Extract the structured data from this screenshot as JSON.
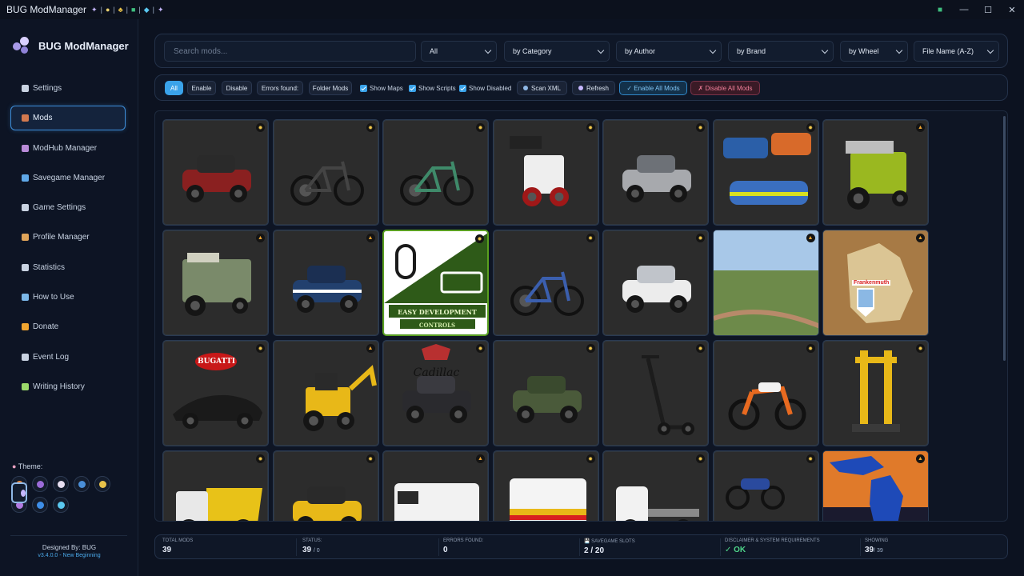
{
  "window": {
    "title": "BUG ModManager",
    "controls": {
      "minimize": "—",
      "maximize": "☐",
      "close": "✕"
    }
  },
  "brand": {
    "title": "BUG ModManager"
  },
  "sidebar": {
    "items": [
      {
        "label": "Settings",
        "icon": "gear-icon",
        "color": "#c9d3e2"
      },
      {
        "label": "Mods",
        "icon": "briefcase-icon",
        "color": "#d2794f"
      },
      {
        "label": "ModHub Manager",
        "icon": "box-icon",
        "color": "#b98bd8"
      },
      {
        "label": "Savegame Manager",
        "icon": "shield-icon",
        "color": "#5fa8e8"
      },
      {
        "label": "Game Settings",
        "icon": "sliders-icon",
        "color": "#c9d3e2"
      },
      {
        "label": "Profile Manager",
        "icon": "user-icon",
        "color": "#e0a45a"
      },
      {
        "label": "Statistics",
        "icon": "chart-icon",
        "color": "#c9d3e2"
      },
      {
        "label": "How to Use",
        "icon": "magnifier-icon",
        "color": "#7bb7e8"
      },
      {
        "label": "Donate",
        "icon": "megaphone-icon",
        "color": "#f0a530"
      },
      {
        "label": "Event Log",
        "icon": "log-icon",
        "color": "#c9d3e2"
      },
      {
        "label": "Writing History",
        "icon": "pencil-icon",
        "color": "#9bd86a"
      }
    ],
    "theme_label": "Theme:",
    "themes": [
      {
        "name": "ember-theme",
        "color": "#f08a3c"
      },
      {
        "name": "violet-theme",
        "color": "#9b6bd8"
      },
      {
        "name": "pearl-theme",
        "color": "#e8e0f2"
      },
      {
        "name": "ocean-theme",
        "color": "#4a8fd8"
      },
      {
        "name": "gold-theme",
        "color": "#e8c24a"
      },
      {
        "name": "orchid-theme",
        "color": "#b07ae0"
      },
      {
        "name": "cobalt-theme",
        "color": "#3e8ee8"
      },
      {
        "name": "bug-theme",
        "color": "#c6b8ff"
      },
      {
        "name": "sky-theme",
        "color": "#5ac8f0"
      }
    ],
    "designed_by": "Designed By: BUG",
    "version": "v3.4.0.0 - New Beginning"
  },
  "filters": {
    "search_placeholder": "Search mods...",
    "type": "All",
    "category": "by Category",
    "author": "by Author",
    "brand": "by Brand",
    "wheel": "by Wheel",
    "sort": "File Name (A-Z)"
  },
  "actions": {
    "all": "All",
    "enable": "Enable",
    "disable": "Disable",
    "errors": "Errors found:",
    "folder_mods": "Folder Mods",
    "show_maps": "Show Maps",
    "show_scripts": "Show Scripts",
    "show_disabled": "Show Disabled",
    "scan_xml": "Scan XML",
    "refresh": "Refresh",
    "enable_all": "✓ Enable All Mods",
    "disable_all": "✗ Disable All Mods"
  },
  "mods": [
    {
      "name": "atv-quad-red",
      "status": "ok"
    },
    {
      "name": "mountain-bike",
      "status": "ok"
    },
    {
      "name": "city-bicycle",
      "status": "ok"
    },
    {
      "name": "skid-steer-loader",
      "status": "ok"
    },
    {
      "name": "silver-suv",
      "status": "ok"
    },
    {
      "name": "police-cars-pack",
      "status": "ok"
    },
    {
      "name": "combine-harvester-green",
      "status": "warn"
    },
    {
      "name": "vintage-combine",
      "status": "warn"
    },
    {
      "name": "offroad-jeep-blue",
      "status": "warn"
    },
    {
      "name": "easy-development-controls",
      "status": "ok",
      "logo_text": "EASY DEVELOPMENT",
      "logo_sub": "CONTROLS"
    },
    {
      "name": "blue-bicycle",
      "status": "ok"
    },
    {
      "name": "white-sedan",
      "status": "ok"
    },
    {
      "name": "farm-map-aerial",
      "status": "warn"
    },
    {
      "name": "frankenmuth-map",
      "status": "warn",
      "map_label": "Frankenmuth"
    },
    {
      "name": "bugatti-hypercar",
      "status": "ok",
      "logo_text": "BUGATTI"
    },
    {
      "name": "backhoe-loader-yellow",
      "status": "warn"
    },
    {
      "name": "cadillac-suv",
      "status": "ok",
      "logo_text": "Cadillac"
    },
    {
      "name": "military-jeep",
      "status": "ok"
    },
    {
      "name": "electric-scooter",
      "status": "ok"
    },
    {
      "name": "dirt-bike",
      "status": "ok"
    },
    {
      "name": "crane-tower",
      "status": "ok"
    },
    {
      "name": "dump-truck",
      "status": "ok"
    },
    {
      "name": "atv-quad-yellow",
      "status": "ok"
    },
    {
      "name": "white-van",
      "status": "warn"
    },
    {
      "name": "ambulance-van",
      "status": "ok"
    },
    {
      "name": "flatbed-truck",
      "status": "ok"
    },
    {
      "name": "blue-motorcycles",
      "status": "ok"
    },
    {
      "name": "michigan-map",
      "status": "warn"
    }
  ],
  "status_icons": {
    "ok": "✹",
    "warn": "▲"
  },
  "footer": {
    "total_mods_label": "TOTAL MODS",
    "total_mods": "39",
    "status_label": "STATUS:",
    "status_value": "39",
    "status_sub": "/ 0",
    "errors_label": "ERRORS FOUND:",
    "errors_value": "0",
    "savegame_label": "💾 SAVEGAME SLOTS",
    "savegame_value": "2 / 20",
    "disclaimer_label": "DISCLAIMER & SYSTEM REQUIREMENTS",
    "disclaimer_value": "✓ OK",
    "showing_label": "SHOWING",
    "showing_value": "39",
    "showing_sub": "/ 39"
  }
}
